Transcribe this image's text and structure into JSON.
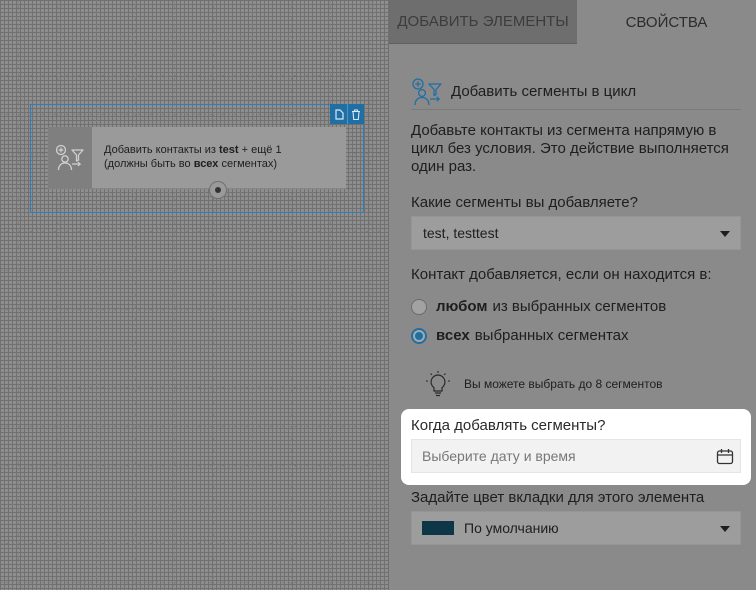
{
  "canvas": {
    "node": {
      "text_prefix": "Добавить контакты из ",
      "text_segment": "test",
      "text_mid": " + ещё 1",
      "text_line2_prefix": "(должны быть во ",
      "text_all": "всех",
      "text_line2_suffix": " сегментах)"
    }
  },
  "panel": {
    "tabs": [
      "ДОБАВИТЬ ЭЛЕМЕНТЫ",
      "СВОЙСТВА"
    ],
    "section_title": "Добавить сегменты в цикл",
    "description": "Добавьте контакты из сегмента напрямую в цикл без условия. Это действие выполняется один раз.",
    "segments_question": "Какие сегменты вы добавляете?",
    "segments_value": "test, testtest",
    "contact_question": "Контакт добавляется, если он находится в:",
    "radio_any_bold": "любом",
    "radio_any_rest": "из выбранных сегментов",
    "radio_all_bold": "всех",
    "radio_all_rest": "выбранных сегментах",
    "hint": "Вы можете выбрать до 8 сегментов",
    "date_question": "Когда добавлять сегменты?",
    "date_placeholder": "Выберите дату и время",
    "color_question": "Задайте цвет вкладки для этого элемента",
    "color_value": "По умолчанию",
    "color_swatch": "#0e3646",
    "accent": "#1f6fa5"
  }
}
